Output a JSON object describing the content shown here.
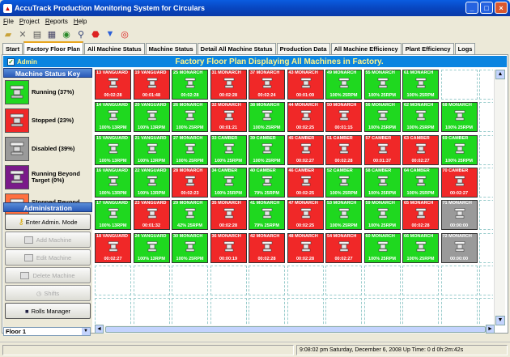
{
  "window": {
    "title": "AccuTrack Production Monitoring System for Circulars"
  },
  "menu": [
    "File",
    "Project",
    "Reports",
    "Help"
  ],
  "toolbar_icons": [
    "open-icon",
    "delete-icon",
    "print-icon",
    "calendar-icon",
    "chart-icon",
    "search-icon",
    "stop-icon",
    "filter-icon",
    "lifebuoy-icon"
  ],
  "tabs": [
    {
      "label": "Start"
    },
    {
      "label": "Factory Floor Plan",
      "active": true
    },
    {
      "label": "All Machine Status"
    },
    {
      "label": "Machine Status"
    },
    {
      "label": "Detail All Machine Status"
    },
    {
      "label": "Production Data"
    },
    {
      "label": "All Machine Efficiency"
    },
    {
      "label": "Plant Efficiency"
    },
    {
      "label": "Logs"
    }
  ],
  "header": {
    "admin_label": "Admin",
    "admin_checked": true,
    "title": "Factory Floor Plan Displaying All Machines in Factory."
  },
  "key": {
    "title": "Machine Status Key",
    "items": [
      {
        "label": "Running (37%)",
        "color": "#1fd81f"
      },
      {
        "label": "Stopped (23%)",
        "color": "#f02828"
      },
      {
        "label": "Disabled (39%)",
        "color": "#9a9a9a"
      },
      {
        "label": "Running Beyond Target (0%)",
        "color": "#7a1a8a"
      },
      {
        "label": "Stopped Beyond Target (0%)",
        "color": "#ff7040"
      }
    ]
  },
  "admin": {
    "title": "Administration",
    "enter": "Enter Admin. Mode",
    "add": "Add Machine",
    "edit": "Edit Machine",
    "delete": "Delete Machine",
    "shifts": "Shifts",
    "rolls": "Rolls Manager"
  },
  "floor": {
    "selected": "Floor 1"
  },
  "colors": {
    "running": "#1fd81f",
    "stopped": "#f02828",
    "disabled": "#9a9a9a"
  },
  "machines": [
    [
      [
        "13 VANGUARD",
        "s",
        "00:02:28"
      ],
      [
        "19 VANGUARD",
        "s",
        "00:01:48"
      ],
      [
        "25 MONARCH",
        "r",
        "00:02:28"
      ],
      [
        "31 MONARCH",
        "s",
        "00:02:28"
      ],
      [
        "37 MONARCH",
        "s",
        "00:02:24"
      ],
      [
        "43 MONARCH",
        "s",
        "00:01:09"
      ],
      [
        "49 MONARCH",
        "r",
        "100% 25RPM"
      ],
      [
        "55 MONARCH",
        "r",
        "100% 25RPM"
      ],
      [
        "61 MONARCH",
        "r",
        "100% 25RPM"
      ],
      null,
      null
    ],
    [
      [
        "14 VANGUARD",
        "r",
        "100% 13RPM"
      ],
      [
        "20 VANGUARD",
        "r",
        "100% 13RPM"
      ],
      [
        "26 MONARCH",
        "r",
        "100% 25RPM"
      ],
      [
        "32 MONARCH",
        "s",
        "00:01:21"
      ],
      [
        "38 MONARCH",
        "r",
        "100% 25RPM"
      ],
      [
        "44 MONARCH",
        "s",
        "00:02:25"
      ],
      [
        "50 MONARCH",
        "s",
        "00:01:15"
      ],
      [
        "56 MONARCH",
        "r",
        "100% 25RPM"
      ],
      [
        "62 MONARCH",
        "r",
        "100% 25RPM"
      ],
      [
        "68 MONARCH",
        "r",
        "100% 25RPM"
      ],
      null
    ],
    [
      [
        "15 VANGUARD",
        "r",
        "100% 13RPM"
      ],
      [
        "21 VANGUARD",
        "r",
        "100% 13RPM"
      ],
      [
        "27 MONARCH",
        "r",
        "100% 25RPM"
      ],
      [
        "33 CAMBER",
        "r",
        "100% 25RPM"
      ],
      [
        "39 CAMBER",
        "r",
        "100% 25RPM"
      ],
      [
        "45 CAMBER",
        "s",
        "00:02:27"
      ],
      [
        "51 CAMBER",
        "s",
        "00:02:28"
      ],
      [
        "57 CAMBER",
        "s",
        "00:01:37"
      ],
      [
        "63 CAMBER",
        "s",
        "00:02:27"
      ],
      [
        "69 CAMBER",
        "r",
        "100% 25RPM"
      ],
      null
    ],
    [
      [
        "16 VANGUARD",
        "r",
        "100% 13RPM"
      ],
      [
        "22 VANGUARD",
        "r",
        "100% 13RPM"
      ],
      [
        "28 MONARCH",
        "s",
        "00:02:23"
      ],
      [
        "34 CAMBER",
        "r",
        "100% 25RPM"
      ],
      [
        "40 CAMBER",
        "r",
        "79% 25RPM"
      ],
      [
        "46 CAMBER",
        "s",
        "00:02:25"
      ],
      [
        "52 CAMBER",
        "r",
        "100% 25RPM"
      ],
      [
        "58 CAMBER",
        "r",
        "100% 25RPM"
      ],
      [
        "64 CAMBER",
        "r",
        "100% 25RPM"
      ],
      [
        "70 CAMBER",
        "s",
        "00:02:27"
      ],
      null
    ],
    [
      [
        "17 VANGUARD",
        "r",
        "100% 13RPM"
      ],
      [
        "23 VANGUARD",
        "s",
        "00:01:32"
      ],
      [
        "29 MONARCH",
        "r",
        "42% 25RPM"
      ],
      [
        "35 MONARCH",
        "s",
        "00:02:28"
      ],
      [
        "41 MONARCH",
        "r",
        "79% 25RPM"
      ],
      [
        "47 MONARCH",
        "s",
        "00:02:25"
      ],
      [
        "53 MONARCH",
        "r",
        "100% 25RPM"
      ],
      [
        "59 MONARCH",
        "r",
        "100% 25RPM"
      ],
      [
        "65 MONARCH",
        "s",
        "00:02:28"
      ],
      [
        "71 MONARCH",
        "d",
        "00:00:00"
      ],
      null
    ],
    [
      [
        "18 VANGUARD",
        "s",
        "00:02:27"
      ],
      [
        "24 VANGUARD",
        "r",
        "100% 13RPM"
      ],
      [
        "30 MONARCH",
        "r",
        "100% 25RPM"
      ],
      [
        "36 MONARCH",
        "s",
        "00:00:19"
      ],
      [
        "42 MONARCH",
        "s",
        "00:02:28"
      ],
      [
        "48 MONARCH",
        "s",
        "00:02:28"
      ],
      [
        "54 MONARCH",
        "s",
        "00:02:27"
      ],
      [
        "60 MONARCH",
        "r",
        "100% 25RPM"
      ],
      [
        "66 MONARCH",
        "r",
        "100% 25RPM"
      ],
      [
        "72 MONARCH",
        "d",
        "00:00:00"
      ],
      null
    ],
    [
      null,
      null,
      null,
      null,
      null,
      null,
      null,
      null,
      null,
      null,
      null
    ],
    [
      null,
      null,
      null,
      null,
      null,
      null,
      null,
      null,
      null,
      null,
      null
    ]
  ],
  "status": {
    "time": "9:08:02 pm  Saturday, December 6, 2008 Up Time: 0 d 0h:2m:42s"
  }
}
